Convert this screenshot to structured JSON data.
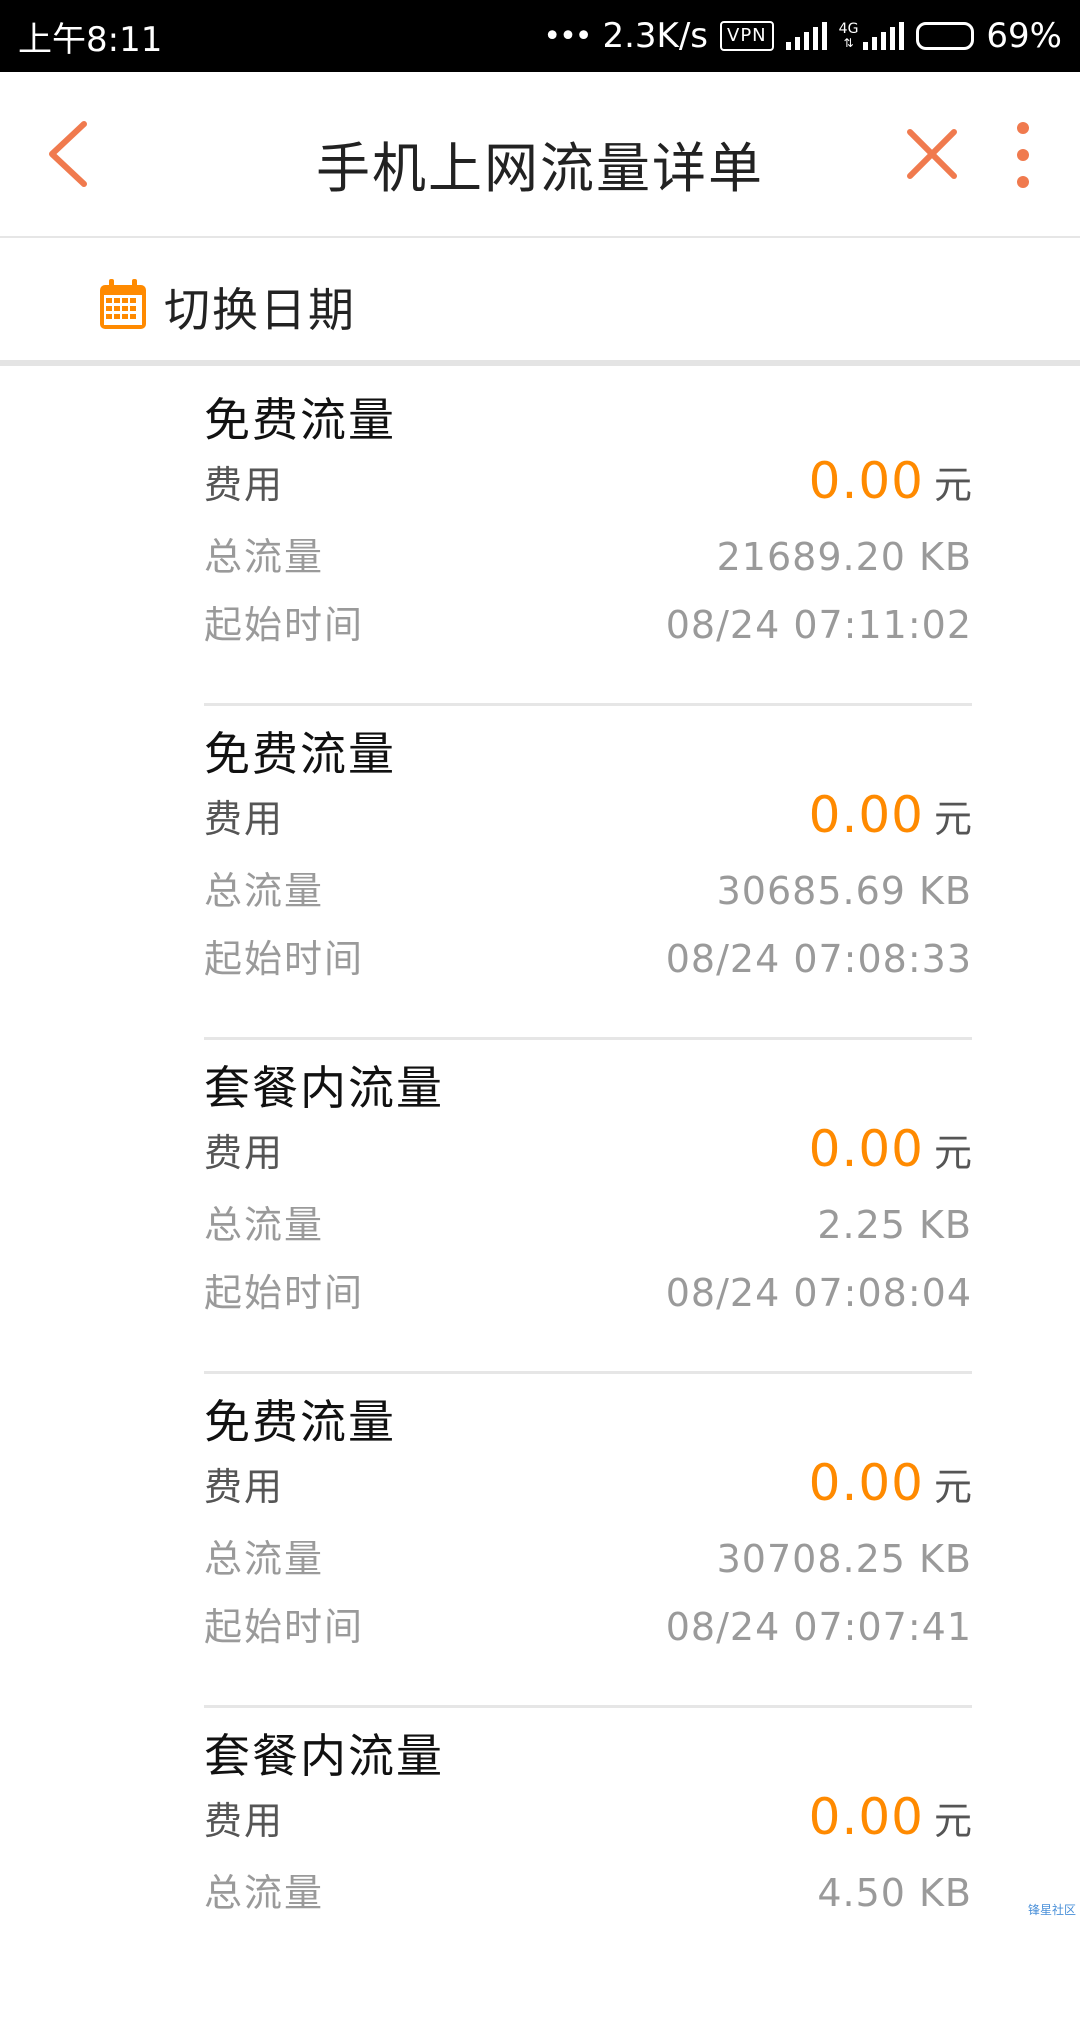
{
  "status_bar": {
    "time": "上午8:11",
    "speed": "2.3K/s",
    "vpn": "VPN",
    "net_label": "4G",
    "battery": "69%",
    "battery_level": 0.69
  },
  "nav": {
    "title": "手机上网流量详单",
    "back_icon": "chevron-left-icon",
    "close_icon": "close-icon",
    "more_icon": "more-vertical-icon",
    "accent_color": "#F07A4E"
  },
  "date_bar": {
    "label": "切换日期",
    "icon": "calendar-icon",
    "icon_color": "#FF8A00"
  },
  "labels": {
    "fee": "费用",
    "traffic": "总流量",
    "start_time": "起始时间",
    "currency": "元"
  },
  "records": [
    {
      "title": "免费流量",
      "fee": "0.00",
      "traffic": "21689.20 KB",
      "start_time": "08/24 07:11:02"
    },
    {
      "title": "免费流量",
      "fee": "0.00",
      "traffic": "30685.69 KB",
      "start_time": "08/24 07:08:33"
    },
    {
      "title": "套餐内流量",
      "fee": "0.00",
      "traffic": "2.25 KB",
      "start_time": "08/24 07:08:04"
    },
    {
      "title": "免费流量",
      "fee": "0.00",
      "traffic": "30708.25 KB",
      "start_time": "08/24 07:07:41"
    },
    {
      "title": "套餐内流量",
      "fee": "0.00",
      "traffic": "4.50 KB",
      "start_time": ""
    }
  ],
  "watermark": "锋星社区",
  "colors": {
    "fee": "#FF8A00",
    "muted": "#9A9A9A",
    "divider": "#E6E6E6"
  }
}
